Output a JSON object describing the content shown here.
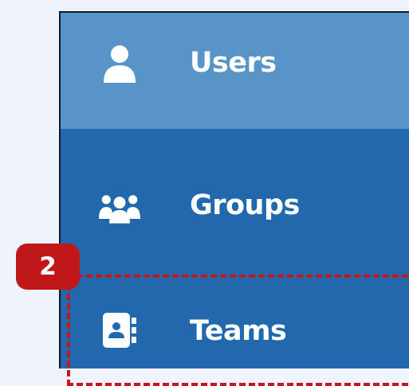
{
  "sidebar": {
    "items": [
      {
        "label": "Users",
        "icon": "user-icon",
        "active": true
      },
      {
        "label": "Groups",
        "icon": "users-group-icon",
        "active": false
      },
      {
        "label": "Teams",
        "icon": "address-book-icon",
        "active": false
      }
    ]
  },
  "annotation": {
    "step_number": "2",
    "color": "#c0171b"
  },
  "colors": {
    "sidebar_bg": "#2268ad",
    "active_item_bg": "#5994c8",
    "page_bg": "#eef4fa"
  }
}
